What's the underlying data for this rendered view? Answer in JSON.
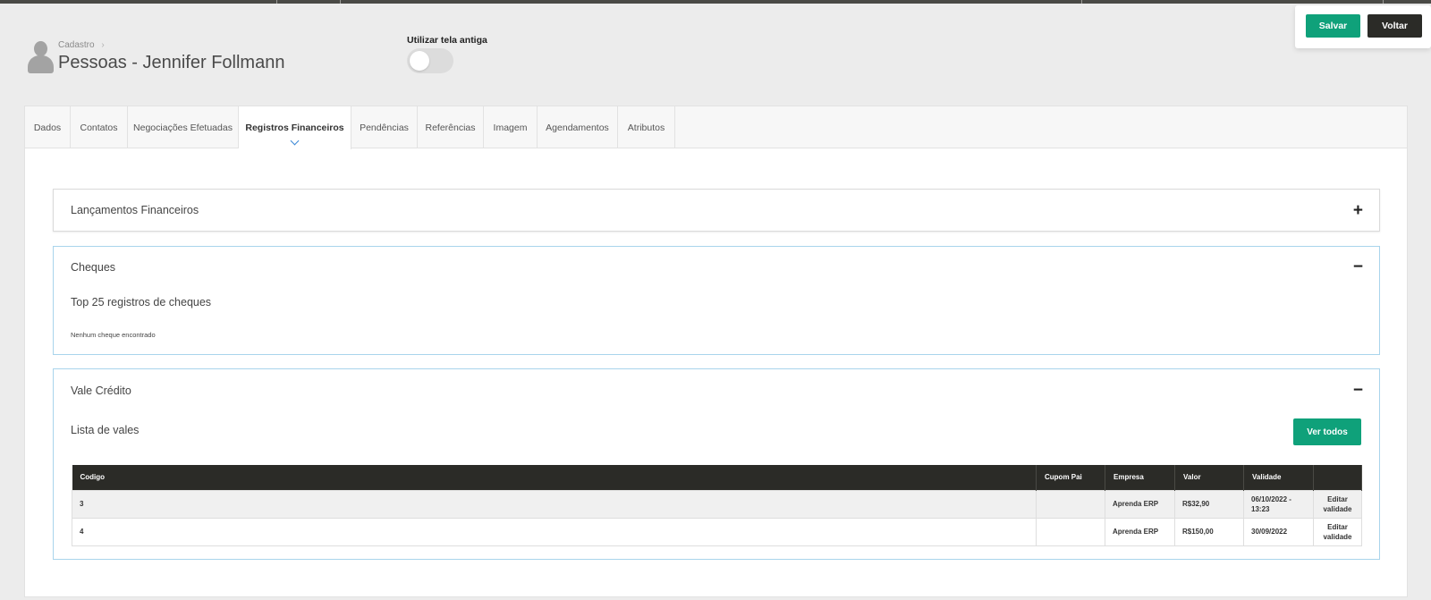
{
  "header": {
    "breadcrumb": "Cadastro",
    "breadcrumb_chevron": "›",
    "title": "Pessoas - Jennifer Follmann",
    "toggle_label": "Utilizar tela antiga"
  },
  "actions": {
    "save_label": "Salvar",
    "back_label": "Voltar"
  },
  "tabs": [
    {
      "label": "Dados"
    },
    {
      "label": "Contatos"
    },
    {
      "label": "Negociações Efetuadas"
    },
    {
      "label": "Registros Financeiros"
    },
    {
      "label": "Pendências"
    },
    {
      "label": "Referências"
    },
    {
      "label": "Imagem"
    },
    {
      "label": "Agendamentos"
    },
    {
      "label": "Atributos"
    }
  ],
  "panels": {
    "lancamentos": {
      "title": "Lançamentos Financeiros",
      "toggle": "+"
    },
    "cheques": {
      "title": "Cheques",
      "toggle": "−",
      "subtitle": "Top 25 registros de cheques",
      "empty_message": "Nenhum cheque encontrado"
    },
    "vale_credito": {
      "title": "Vale Crédito",
      "toggle": "−",
      "subtitle": "Lista de vales",
      "ver_todos_label": "Ver todos",
      "columns": [
        "Codigo",
        "Cupom Pai",
        "Empresa",
        "Valor",
        "Validade",
        ""
      ],
      "rows": [
        {
          "codigo": "3",
          "cupom_pai": "",
          "empresa": "Aprenda ERP",
          "valor": "R$32,90",
          "validade": "06/10/2022 - 13:23",
          "acao": "Editar validade"
        },
        {
          "codigo": "4",
          "cupom_pai": "",
          "empresa": "Aprenda ERP",
          "valor": "R$150,00",
          "validade": "30/09/2022",
          "acao": "Editar validade"
        }
      ]
    }
  }
}
